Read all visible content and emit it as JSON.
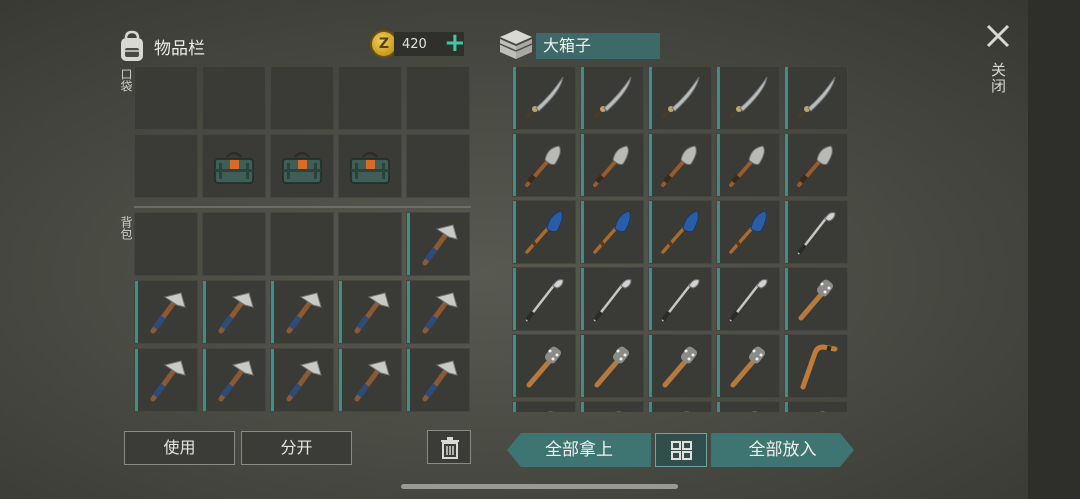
{
  "inventory": {
    "title": "物品栏",
    "pocket_label": "口袋",
    "backpack_label": "背包",
    "coins": "420",
    "coin_letter": "Z",
    "add_coins": "+",
    "pocket_slots": [
      "empty",
      "empty",
      "empty",
      "empty",
      "empty",
      "empty",
      "ammo-box",
      "ammo-box",
      "ammo-box",
      "empty"
    ],
    "backpack_slots": [
      "empty",
      "empty",
      "empty",
      "empty",
      "pickaxe",
      "pickaxe",
      "pickaxe",
      "pickaxe",
      "pickaxe",
      "pickaxe",
      "pickaxe",
      "pickaxe",
      "pickaxe",
      "pickaxe",
      "pickaxe"
    ]
  },
  "chest": {
    "title": "大箱子",
    "slots": [
      "machete",
      "machete",
      "machete",
      "machete",
      "machete",
      "shovel",
      "shovel",
      "shovel",
      "shovel",
      "shovel",
      "oar",
      "oar",
      "oar",
      "oar",
      "golf-club",
      "golf-club",
      "golf-club",
      "golf-club",
      "golf-club",
      "spiked-bat",
      "spiked-bat",
      "spiked-bat",
      "spiked-bat",
      "spiked-bat",
      "hockey-stick",
      "hockey-stick",
      "hockey-stick",
      "hockey-stick",
      "hockey-stick",
      "hockey-stick"
    ]
  },
  "buttons": {
    "use": "使用",
    "split": "分开",
    "take_all": "全部拿上",
    "put_all": "全部放入",
    "close": "关闭"
  },
  "icons": {
    "backpack": "backpack-icon",
    "chest": "chest-icon",
    "coin": "coin-icon",
    "trash": "trash-icon",
    "sort": "sort-grid-icon",
    "close": "close-icon"
  },
  "colors": {
    "accent": "#3e7471",
    "coin_plus": "#3fc7a5",
    "title_bg": "#3d6a68"
  }
}
